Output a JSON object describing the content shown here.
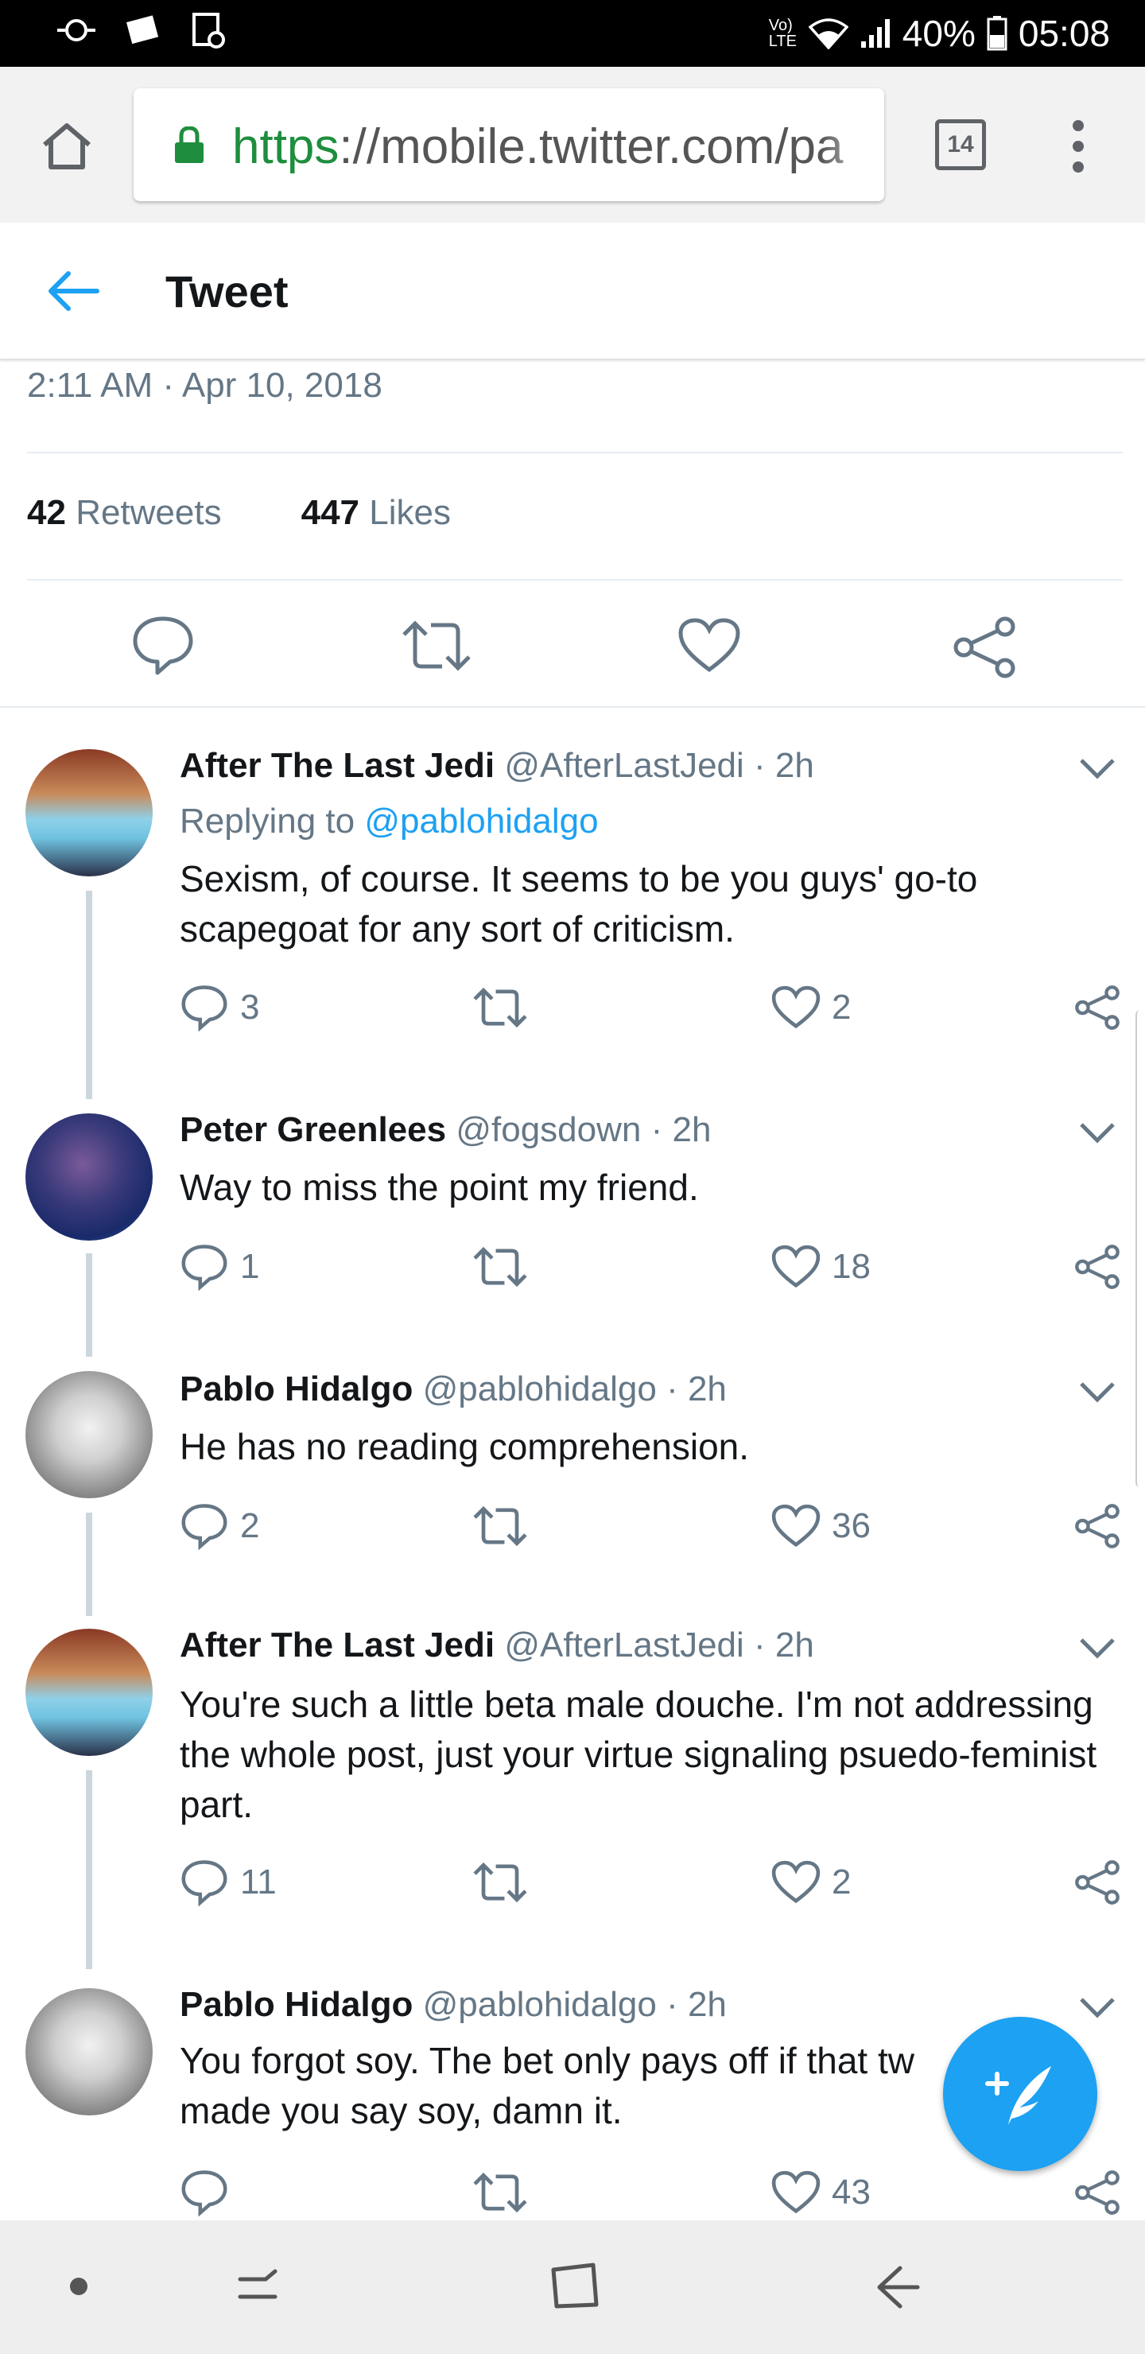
{
  "status_bar": {
    "network_label": "Vo) LTE",
    "battery": "40%",
    "time": "05:08"
  },
  "browser": {
    "url_scheme": "https",
    "url_rest": "://mobile.twitter.com/pa",
    "tab_count": "14"
  },
  "header": {
    "title": "Tweet"
  },
  "tweet": {
    "timestamp": "2:11 AM · Apr 10, 2018",
    "retweets_count": "42",
    "retweets_label": "Retweets",
    "likes_count": "447",
    "likes_label": "Likes"
  },
  "replies": [
    {
      "name": "After The Last Jedi",
      "handle": "@AfterLastJedi",
      "age": "· 2h",
      "replying_prefix": "Replying to",
      "replying_to": "@pablohidalgo",
      "text": "Sexism, of course. It seems to be you guys' go-to scapegoat for any sort of criticism.",
      "replies": "3",
      "likes": "2"
    },
    {
      "name": "Peter Greenlees",
      "handle": "@fogsdown",
      "age": "· 2h",
      "text": "Way to miss the point my friend.",
      "replies": "1",
      "likes": "18"
    },
    {
      "name": "Pablo Hidalgo",
      "handle": "@pablohidalgo",
      "age": "· 2h",
      "text": "He has no reading comprehension.",
      "replies": "2",
      "likes": "36"
    },
    {
      "name": "After The Last Jedi",
      "handle": "@AfterLastJedi",
      "age": "· 2h",
      "text": "You're such a little beta male douche. I'm not addressing the whole post, just your virtue signaling psuedo-feminist part.",
      "replies": "11",
      "likes": "2"
    },
    {
      "name": "Pablo Hidalgo",
      "handle": "@pablohidalgo",
      "age": "· 2h",
      "text_line1": "You forgot soy. The bet only pays off if that tw",
      "text_line2": "made you say soy, damn it.",
      "replies": "",
      "likes": "43"
    }
  ],
  "colors": {
    "accent": "#1da1f2",
    "text_primary": "#14171a",
    "text_secondary": "#657786"
  }
}
